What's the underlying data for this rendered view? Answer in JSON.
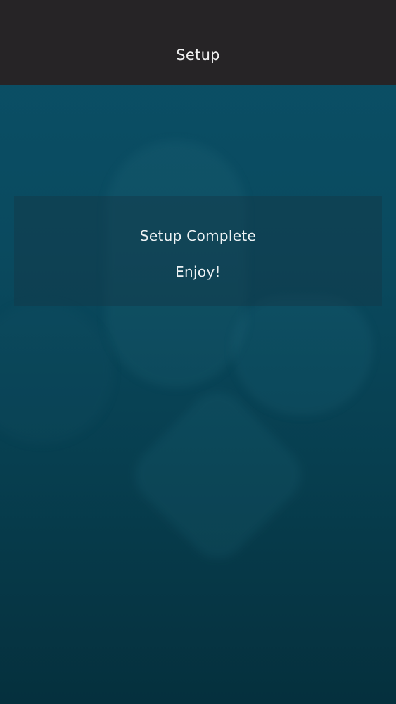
{
  "header": {
    "title": "Setup"
  },
  "message": {
    "title": "Setup Complete",
    "subtitle": "Enjoy!"
  },
  "colors": {
    "header_background": "#262426",
    "background_top": "#0b5067",
    "background_bottom": "#05303d",
    "text": "#eef3f5"
  }
}
